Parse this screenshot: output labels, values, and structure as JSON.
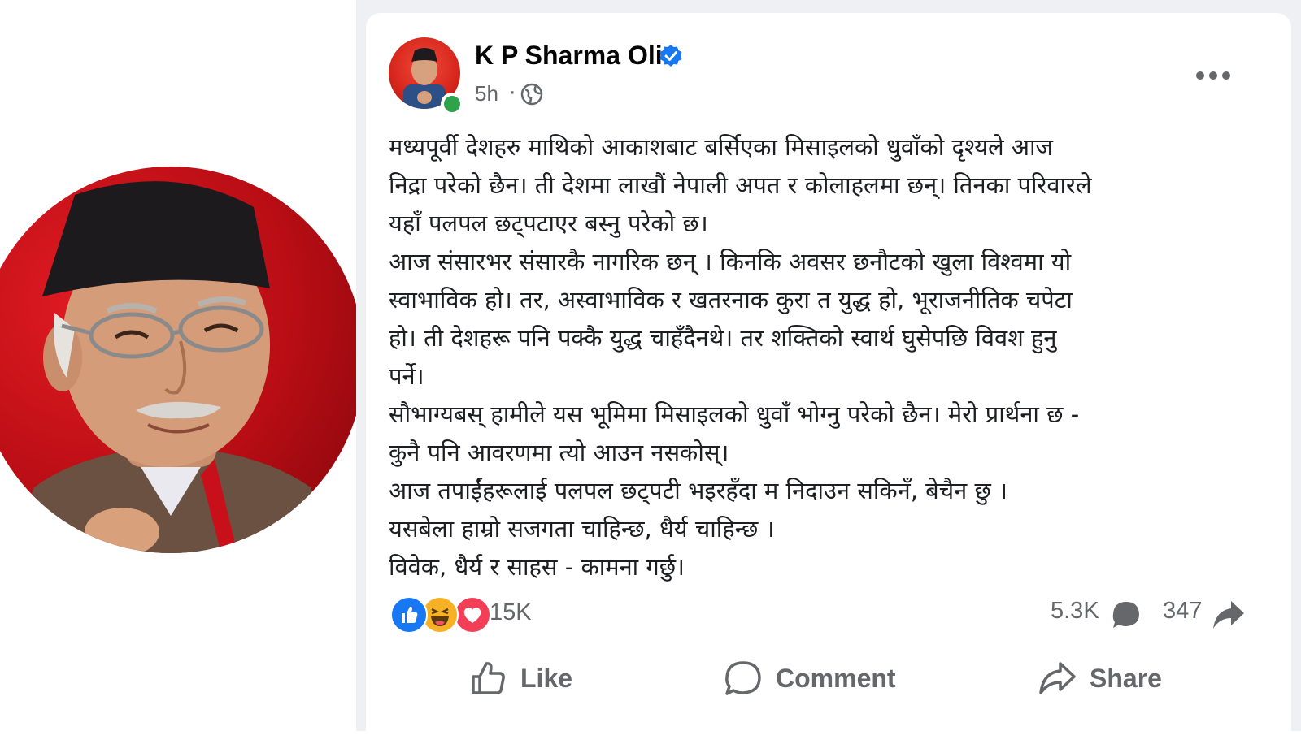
{
  "post": {
    "author": "K P Sharma Oli",
    "time": "5h",
    "separator": "·",
    "body_lines": [
      "मध्यपूर्वी देशहरु माथिको आकाशबाट बर्सिएका  मिसाइलको धुवाँको दृश्यले आज",
      "निद्रा परेको छैन। ती देशमा लाखौं नेपाली अपत र कोलाहलमा छन्। तिनका परिवारले",
      "यहाँ पलपल छट्पटाएर बस्नु परेको छ।",
      "आज संसारभर संसारकै नागरिक छन् । किनकि अवसर छनौटको खुला विश्वमा यो",
      "स्वाभाविक हो।  तर, अस्वाभाविक र खतरनाक कुरा त युद्ध हो, भूराजनीतिक चपेटा",
      "हो। ती देशहरू पनि पक्कै युद्ध चाहँदैनथे। तर शक्तिको स्वार्थ घुसेपछि विवश हुनु",
      "पर्ने।",
      "सौभाग्यबस् हामीले यस भूमिमा मिसाइलको धुवाँ  भोग्नु परेको छैन। मेरो प्रार्थना छ -",
      "कुनै पनि आवरणमा त्यो आउन नसकोस्।",
      "आज तपाईंहरूलाई पलपल छट्पटी भइरहँदा म निदाउन सकिनँ, बेचैन छु ।",
      "यसबेला हाम्रो सजगता चाहिन्छ, धैर्य चाहिन्छ ।",
      "विवेक, धैर्य र साहस -  कामना गर्छु।"
    ],
    "reaction_count": "15K",
    "comment_count": "5.3K",
    "share_count": "347"
  },
  "actions": {
    "like": "Like",
    "comment": "Comment",
    "share": "Share"
  },
  "icons": {
    "verified": "verified-badge-icon",
    "audience": "globe-icon",
    "more": "more-options-icon",
    "reactions": [
      "like-reaction-icon",
      "haha-reaction-icon",
      "love-reaction-icon"
    ]
  },
  "colors": {
    "brand_blue": "#1877f2",
    "secondary_text": "#65676b",
    "online_green": "#31a24c"
  }
}
